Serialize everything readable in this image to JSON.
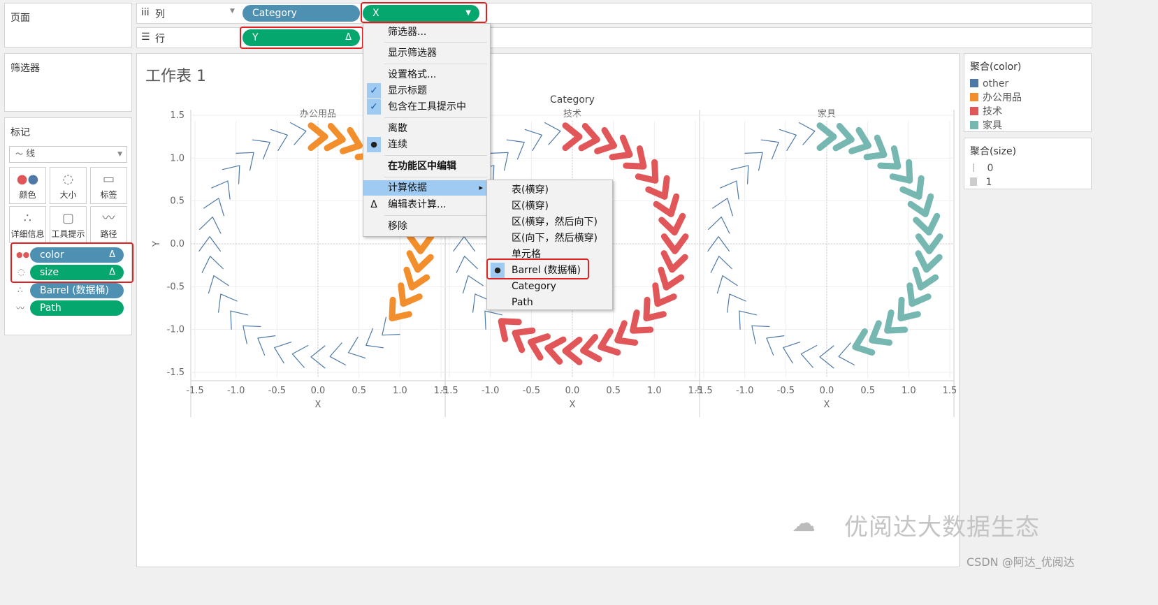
{
  "pages_panel": {
    "title": "页面"
  },
  "filters_panel": {
    "title": "筛选器"
  },
  "marks": {
    "title": "标记",
    "mark_type": "线",
    "buttons": [
      {
        "label": "颜色",
        "icon": "color-dots-icon"
      },
      {
        "label": "大小",
        "icon": "size-icon"
      },
      {
        "label": "标签",
        "icon": "label-icon"
      },
      {
        "label": "详细信息",
        "icon": "detail-icon"
      },
      {
        "label": "工具提示",
        "icon": "tooltip-icon"
      },
      {
        "label": "路径",
        "icon": "path-icon"
      }
    ],
    "fields": [
      {
        "label": "color",
        "delta": "Δ",
        "icon": "color-icon"
      },
      {
        "label": "size",
        "delta": "Δ",
        "icon": "size-icon"
      },
      {
        "label": "Barrel (数据桶)",
        "icon": "detail-icon"
      },
      {
        "label": "Path",
        "icon": "path-icon"
      }
    ]
  },
  "columns_shelf": {
    "label": "列",
    "icon": "columns-icon",
    "pills": [
      {
        "label": "Category"
      },
      {
        "label": "X",
        "dropdown": "▼"
      }
    ]
  },
  "rows_shelf": {
    "label": "行",
    "icon": "rows-icon",
    "pills": [
      {
        "label": "Y",
        "delta": "Δ"
      }
    ]
  },
  "worksheet": {
    "title": "工作表 1",
    "header": "Category",
    "panes": [
      "办公用品",
      "技术",
      "家具"
    ],
    "x_label": "X",
    "y_label": "Y"
  },
  "context_menu": {
    "items": [
      "筛选器...",
      "显示筛选器",
      "设置格式...",
      "显示标题",
      "包含在工具提示中",
      "离散",
      "连续",
      "在功能区中编辑",
      "计算依据",
      "编辑表计算...",
      "移除"
    ],
    "check_mark": "✓",
    "bullet": "●",
    "arrow": "▸",
    "delta": "Δ"
  },
  "submenu": {
    "items": [
      "表(横穿)",
      "区(横穿)",
      "区(横穿，然后向下)",
      "区(向下，然后横穿)",
      "单元格",
      "Barrel (数据桶)",
      "Category",
      "Path"
    ],
    "selected": "Barrel (数据桶)"
  },
  "legend_color": {
    "title": "聚合(color)",
    "items": [
      {
        "label": "other",
        "color": "#4e79a7"
      },
      {
        "label": "办公用品",
        "color": "#f28e2b"
      },
      {
        "label": "技术",
        "color": "#e15759"
      },
      {
        "label": "家具",
        "color": "#76b7b2"
      }
    ]
  },
  "legend_size": {
    "title": "聚合(size)",
    "items": [
      "0",
      "1"
    ]
  },
  "watermark": {
    "brand": "优阅达大数据生态",
    "credit": "CSDN @阿达_优阅达"
  },
  "chart_data": {
    "type": "line",
    "facets": [
      "办公用品",
      "技术",
      "家具"
    ],
    "xlabel": "X",
    "ylabel": "Y",
    "xlim": [
      -1.5,
      1.5
    ],
    "ylim": [
      -1.5,
      1.5
    ],
    "x_ticks": [
      "-1.5",
      "-1.0",
      "-0.5",
      "0.0",
      "0.5",
      "1.0",
      "1.5"
    ],
    "y_ticks": [
      "1.5",
      "1.0",
      "0.5",
      "0.0",
      "-0.5",
      "-1.0",
      "-1.5"
    ],
    "grid": true,
    "series": [
      {
        "name": "办公用品",
        "color": "#f28e2b",
        "highlight_range_deg": [
          -45,
          90
        ],
        "highlight_radius": 1.25
      },
      {
        "name": "技术",
        "color": "#e15759",
        "highlight_range_deg": [
          -135,
          90
        ],
        "highlight_radius": 1.25
      },
      {
        "name": "家具",
        "color": "#76b7b2",
        "highlight_range_deg": [
          -75,
          90
        ],
        "highlight_radius": 1.25
      }
    ],
    "other_color": "#4e79a7",
    "chevron_count": 36
  }
}
